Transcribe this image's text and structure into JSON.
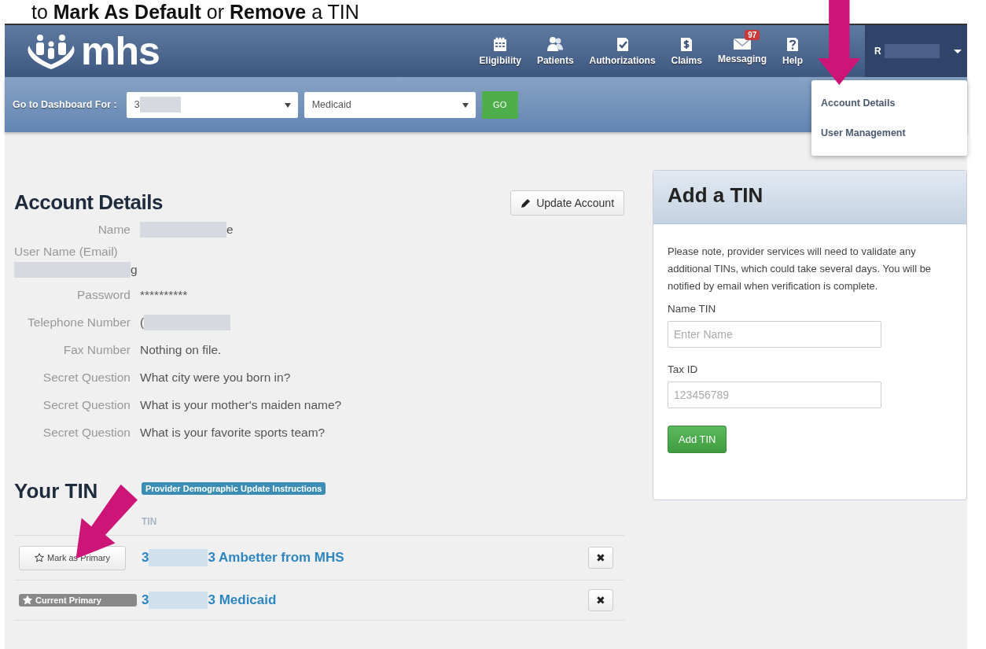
{
  "caption": "to **Mark As Default** or **Remove** a TIN",
  "header": {
    "logo": "mhs",
    "nav": [
      {
        "label": "Eligibility"
      },
      {
        "label": "Patients"
      },
      {
        "label": "Authorizations"
      },
      {
        "label": "Claims"
      },
      {
        "label": "Messaging",
        "badge": "97"
      },
      {
        "label": "Help"
      }
    ],
    "user": {
      "initial": "R",
      "expanded": true
    }
  },
  "user_menu": [
    "Account Details",
    "User Management"
  ],
  "dashboard_bar": {
    "label": "Go to Dashboard For :",
    "provider_start": "3",
    "plan": "Medicaid",
    "go": "GO"
  },
  "account": {
    "title": "Account Details",
    "update_button": "Update Account",
    "fields": [
      {
        "kind": "inline",
        "label": "Name",
        "value_end": "e"
      },
      {
        "kind": "stacked",
        "label": "User Name (Email)",
        "value_end": "g"
      },
      {
        "kind": "inline",
        "label": "Password",
        "value": "**********"
      },
      {
        "kind": "inline",
        "label": "Telephone Number",
        "value_start": "("
      },
      {
        "kind": "inline",
        "label": "Fax Number",
        "value": "Nothing on file."
      },
      {
        "kind": "inline",
        "label": "Secret Question",
        "value": "What city were you born in?"
      },
      {
        "kind": "inline",
        "label": "Secret Question",
        "value": "What is your mother's maiden name?"
      },
      {
        "kind": "inline",
        "label": "Secret Question",
        "value": "What is your favorite sports team?"
      }
    ]
  },
  "tins": {
    "title": "Your TIN",
    "instructions": "Provider Demographic Update Instructions",
    "column": "TIN",
    "rows": [
      {
        "primary": false,
        "action": "Mark as Primary",
        "tin_start": "3",
        "name": "3 Ambetter from MHS",
        "remove": "✖"
      },
      {
        "primary": true,
        "action": "Current Primary",
        "tin_start": "3",
        "name": "3 Medicaid",
        "remove": "✖"
      }
    ]
  },
  "add_tin": {
    "title": "Add a TIN",
    "note": "Please note, provider services will need to validate any additional TINs, which could take several days. You will be notified by email when verification is complete.",
    "name_label": "Name TIN",
    "name_placeholder": "Enter Name",
    "tax_label": "Tax ID",
    "tax_placeholder": "123456789",
    "button": "Add TIN"
  }
}
